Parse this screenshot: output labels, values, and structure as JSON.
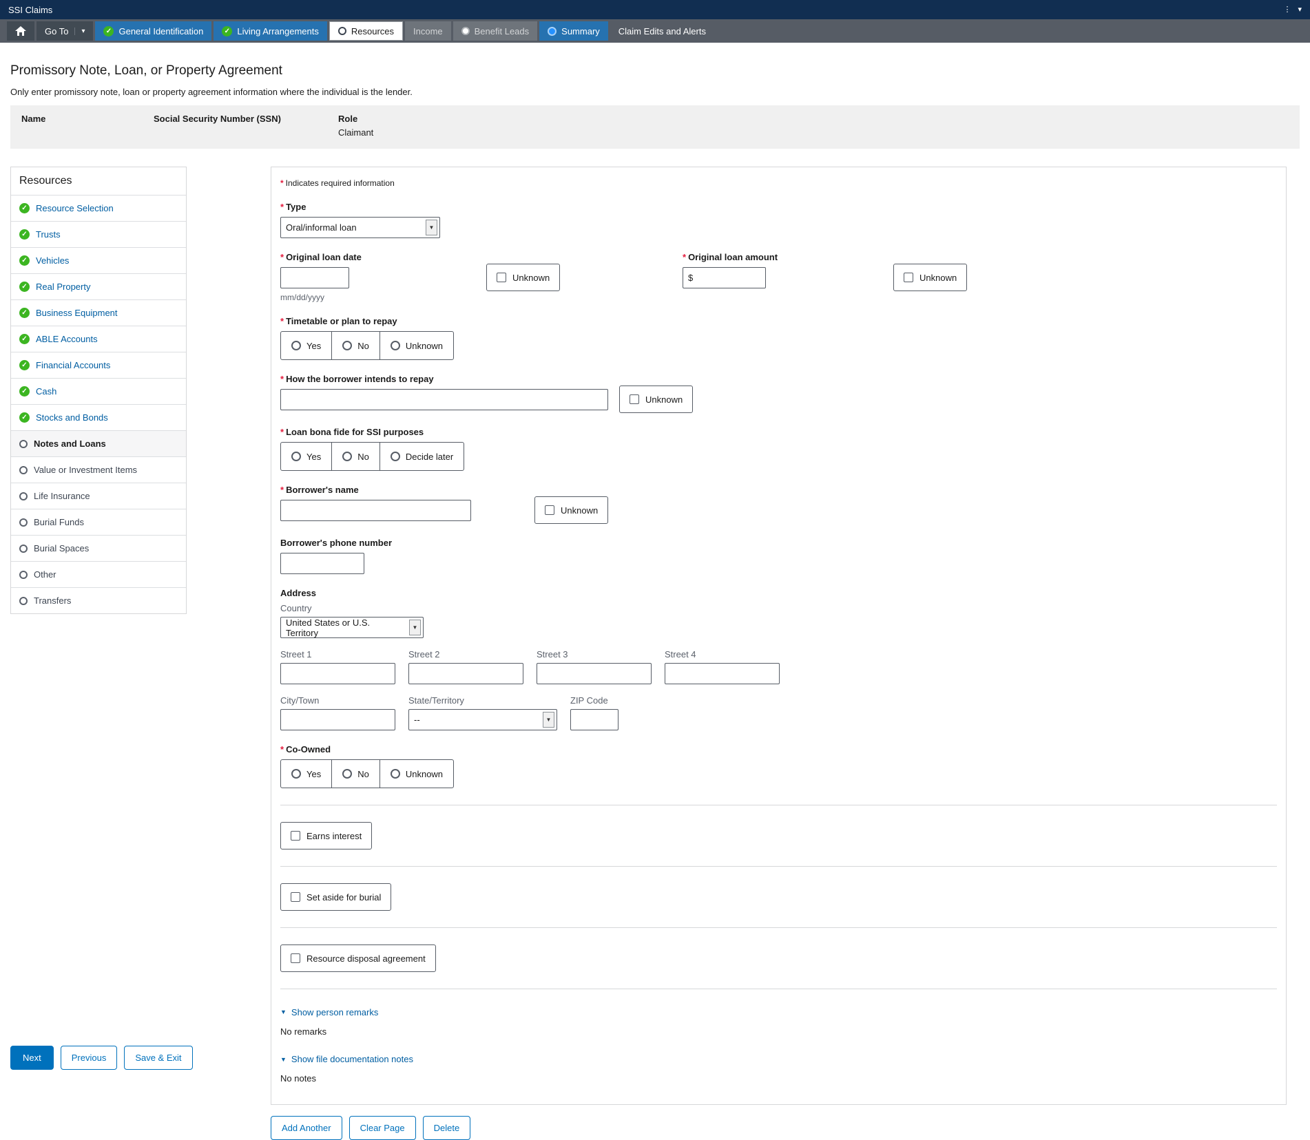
{
  "colors": {
    "topbar": "#112e51",
    "navbar": "#565c65",
    "tab_blue": "#2672b0",
    "success_green": "#3cb521",
    "link_blue": "#005ea2",
    "accent_blue": "#0071bc",
    "required_red": "#e31c3d"
  },
  "topbar": {
    "title": "SSI Claims"
  },
  "nav": {
    "goto_label": "Go To",
    "tabs": [
      {
        "label": "General Identification"
      },
      {
        "label": "Living Arrangements"
      },
      {
        "label": "Resources"
      },
      {
        "label": "Income"
      },
      {
        "label": "Benefit Leads"
      },
      {
        "label": "Summary"
      },
      {
        "label": "Claim Edits and Alerts"
      }
    ]
  },
  "page": {
    "title": "Promissory Note, Loan, or Property Agreement",
    "subtitle": "Only enter promissory note, loan or property agreement information where the individual is the lender.",
    "person": {
      "name_label": "Name",
      "ssn_label": "Social Security Number (SSN)",
      "role_label": "Role",
      "role_value": "Claimant"
    }
  },
  "sidebar": {
    "title": "Resources",
    "items": [
      {
        "label": "Resource Selection",
        "state": "complete"
      },
      {
        "label": "Trusts",
        "state": "complete"
      },
      {
        "label": "Vehicles",
        "state": "complete"
      },
      {
        "label": "Real Property",
        "state": "complete"
      },
      {
        "label": "Business Equipment",
        "state": "complete"
      },
      {
        "label": "ABLE Accounts",
        "state": "complete"
      },
      {
        "label": "Financial Accounts",
        "state": "complete"
      },
      {
        "label": "Cash",
        "state": "complete"
      },
      {
        "label": "Stocks and Bonds",
        "state": "complete"
      },
      {
        "label": "Notes and Loans",
        "state": "current"
      },
      {
        "label": "Value or Investment Items",
        "state": "pending"
      },
      {
        "label": "Life Insurance",
        "state": "pending"
      },
      {
        "label": "Burial Funds",
        "state": "pending"
      },
      {
        "label": "Burial Spaces",
        "state": "pending"
      },
      {
        "label": "Other",
        "state": "pending"
      },
      {
        "label": "Transfers",
        "state": "pending"
      }
    ]
  },
  "form": {
    "required_note": "Indicates required information",
    "type": {
      "label": "Type",
      "value": "Oral/informal loan"
    },
    "loan_date": {
      "label": "Original loan date",
      "hint": "mm/dd/yyyy",
      "unknown": "Unknown"
    },
    "loan_amount": {
      "label": "Original loan amount",
      "prefix": "$",
      "unknown": "Unknown"
    },
    "timetable": {
      "label": "Timetable or plan to repay",
      "options": [
        "Yes",
        "No",
        "Unknown"
      ]
    },
    "repay": {
      "label": "How the borrower intends to repay",
      "unknown": "Unknown"
    },
    "bona_fide": {
      "label": "Loan bona fide for SSI purposes",
      "options": [
        "Yes",
        "No",
        "Decide later"
      ]
    },
    "borrower_name": {
      "label": "Borrower's name",
      "unknown": "Unknown"
    },
    "borrower_phone": {
      "label": "Borrower's phone number"
    },
    "address": {
      "heading": "Address",
      "country_label": "Country",
      "country_value": "United States or U.S. Territory",
      "street1": "Street 1",
      "street2": "Street 2",
      "street3": "Street 3",
      "street4": "Street 4",
      "city": "City/Town",
      "state": "State/Territory",
      "state_value": "--",
      "zip": "ZIP Code"
    },
    "co_owned": {
      "label": "Co-Owned",
      "options": [
        "Yes",
        "No",
        "Unknown"
      ]
    },
    "earns_interest": "Earns interest",
    "set_aside": "Set aside for burial",
    "resource_disposal": "Resource disposal agreement",
    "person_remarks": {
      "toggle": "Show person remarks",
      "empty": "No remarks"
    },
    "file_notes": {
      "toggle": "Show file documentation notes",
      "empty": "No notes"
    },
    "actions": {
      "add_another": "Add Another",
      "clear_page": "Clear Page",
      "delete": "Delete"
    }
  },
  "footer": {
    "next": "Next",
    "previous": "Previous",
    "save_exit": "Save & Exit"
  }
}
